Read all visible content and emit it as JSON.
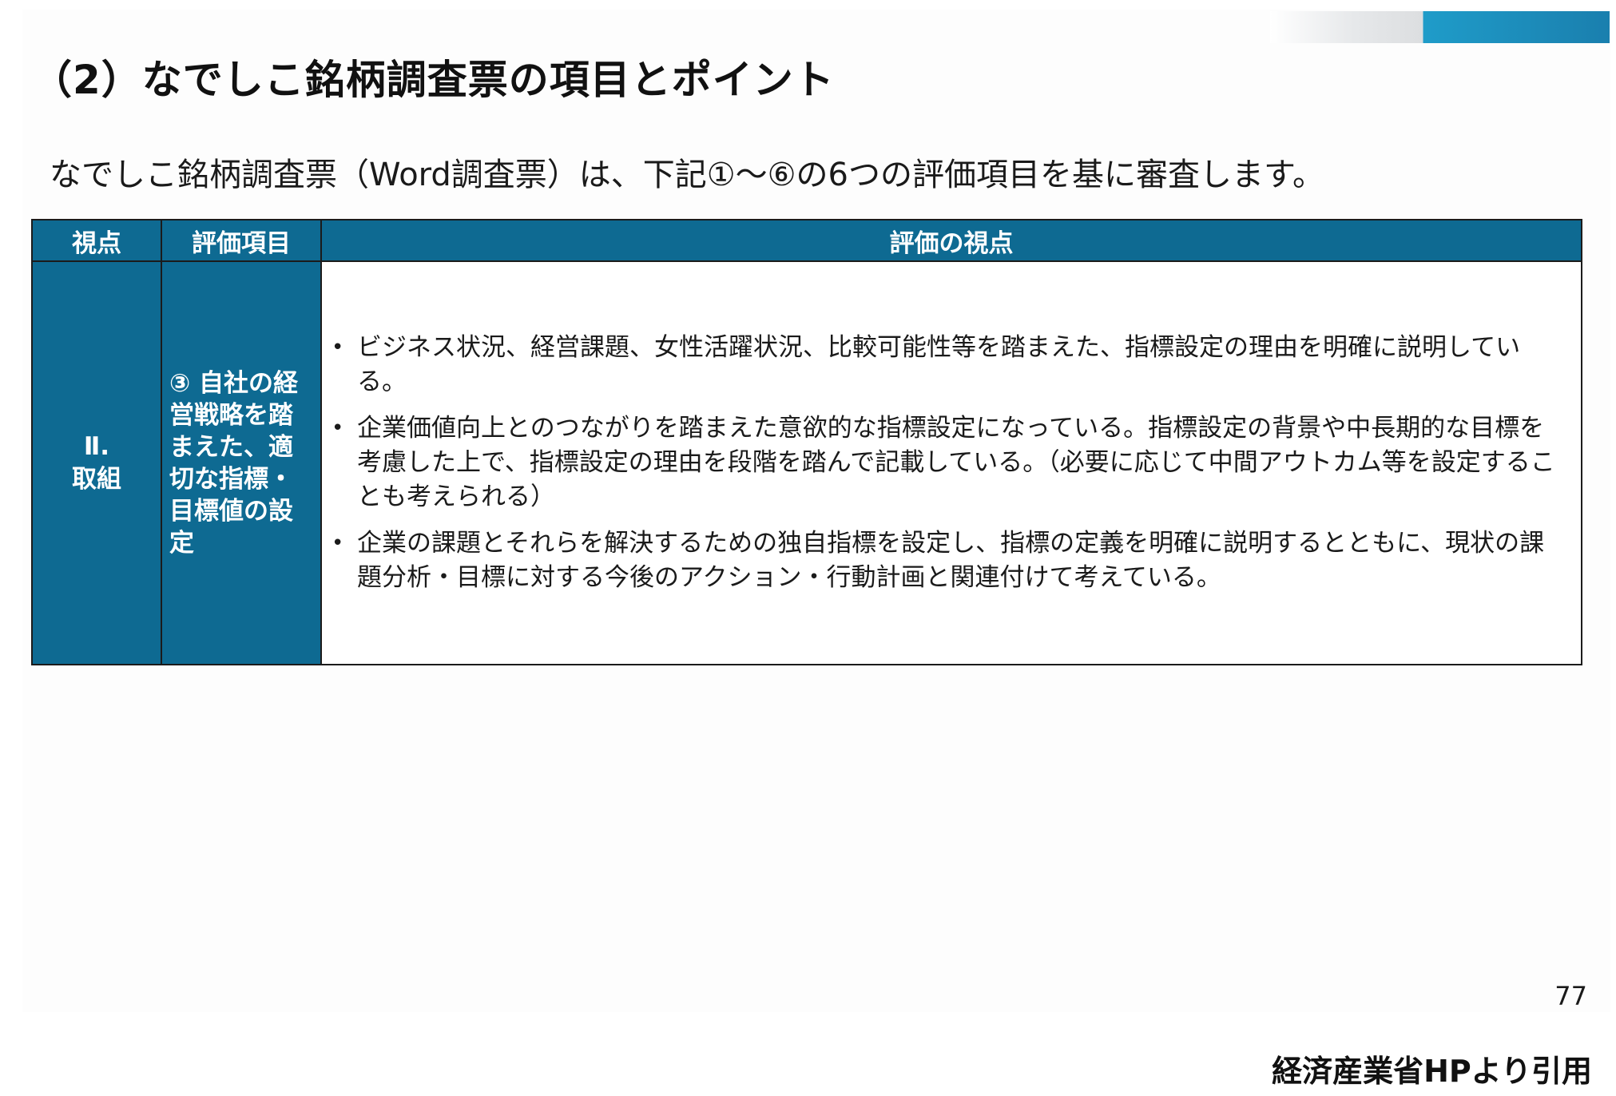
{
  "slide": {
    "title": "（2）なでしこ銘柄調査票の項目とポイント",
    "intro": "なでしこ銘柄調査票（Word調査票）は、下記①～⑥の6つの評価項目を基に審査します。",
    "page_number": "77",
    "accent_colors": [
      "#1f9cc9",
      "#1a7fae"
    ]
  },
  "table": {
    "header": {
      "perspective": "視点",
      "item": "評価項目",
      "points": "評価の視点"
    },
    "header_bg": "#0e6a92",
    "row": {
      "perspective_line1": "Ⅱ.",
      "perspective_line2": "取組",
      "item": "③ 自社の経営戦略を踏まえた、適切な指標・目標値の設定",
      "points": [
        "ビジネス状況、経営課題、女性活躍状況、比較可能性等を踏まえた、指標設定の理由を明確に説明している。",
        "企業価値向上とのつながりを踏まえた意欲的な指標設定になっている。指標設定の背景や中長期的な目標を考慮した上で、指標設定の理由を段階を踏んで記載している。（必要に応じて中間アウトカム等を設定することも考えられる）",
        "企業の課題とそれらを解決するための独自指標を設定し、指標の定義を明確に説明するとともに、現状の課題分析・目標に対する今後のアクション・行動計画と関連付けて考えている。"
      ]
    }
  },
  "footer": {
    "source": "経済産業省HPより引用"
  }
}
